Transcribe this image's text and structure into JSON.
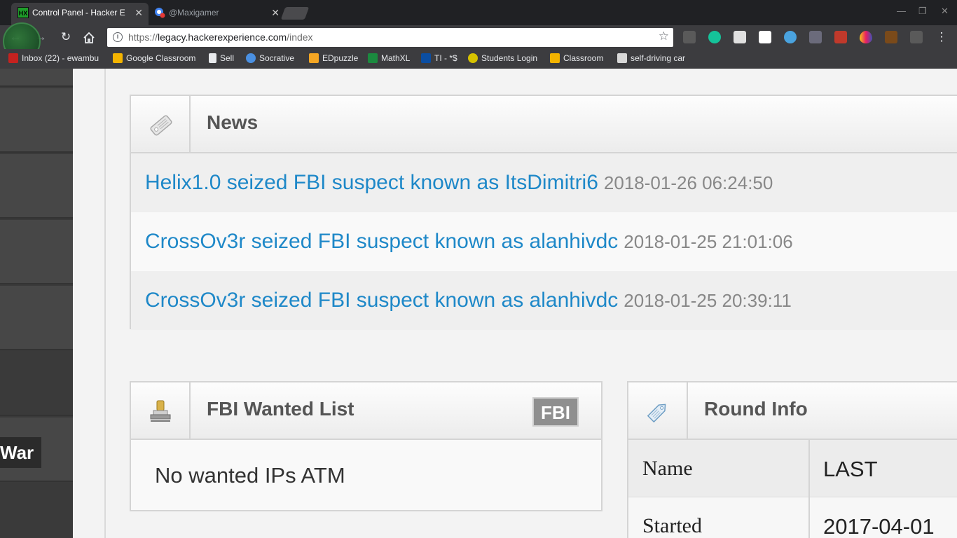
{
  "browser": {
    "tabs": [
      {
        "title": "Control Panel - Hacker E",
        "active": true
      },
      {
        "title": "@Maxigamer",
        "active": false
      }
    ],
    "url_domain": "legacy.hackerexperience.com",
    "url_prefix": "https://",
    "url_path": "/index",
    "bookmarks": [
      {
        "label": "Inbox (22) - ewambu",
        "icon": "gmail-icon",
        "color": "#c5221f"
      },
      {
        "label": "Google Classroom",
        "icon": "classroom-icon",
        "color": "#f4b400"
      },
      {
        "label": "Sell",
        "icon": "page-icon",
        "color": "#e8eaed"
      },
      {
        "label": "Socrative",
        "icon": "socrative-icon",
        "color": "#4a90e2"
      },
      {
        "label": "EDpuzzle",
        "icon": "edpuzzle-icon",
        "color": "#f5a623"
      },
      {
        "label": "MathXL",
        "icon": "mathxl-icon",
        "color": "#1b8a3f"
      },
      {
        "label": "TI - *$",
        "icon": "ti-icon",
        "color": "#0b4ea2"
      },
      {
        "label": "Students Login",
        "icon": "students-icon",
        "color": "#d6c200"
      },
      {
        "label": "Classroom",
        "icon": "classroom-icon",
        "color": "#f4b400"
      },
      {
        "label": "self-driving car",
        "icon": "folder-icon",
        "color": "#d8d8d8"
      }
    ]
  },
  "sidebar": {
    "war_label": "War"
  },
  "news": {
    "title": "News",
    "items": [
      {
        "text": "Helix1.0 seized FBI suspect known as ItsDimitri6",
        "date": "2018-01-26 06:24:50"
      },
      {
        "text": "CrossOv3r seized FBI suspect known as alanhivdc",
        "date": "2018-01-25 21:01:06"
      },
      {
        "text": "CrossOv3r seized FBI suspect known as alanhivdc",
        "date": "2018-01-25 20:39:11"
      }
    ]
  },
  "fbi": {
    "title": "FBI Wanted List",
    "badge": "FBI",
    "empty_text": "No wanted IPs ATM"
  },
  "round": {
    "title": "Round Info",
    "rows": [
      {
        "key": "Name",
        "value": "LAST"
      },
      {
        "key": "Started",
        "value": "2017-04-01"
      }
    ]
  }
}
